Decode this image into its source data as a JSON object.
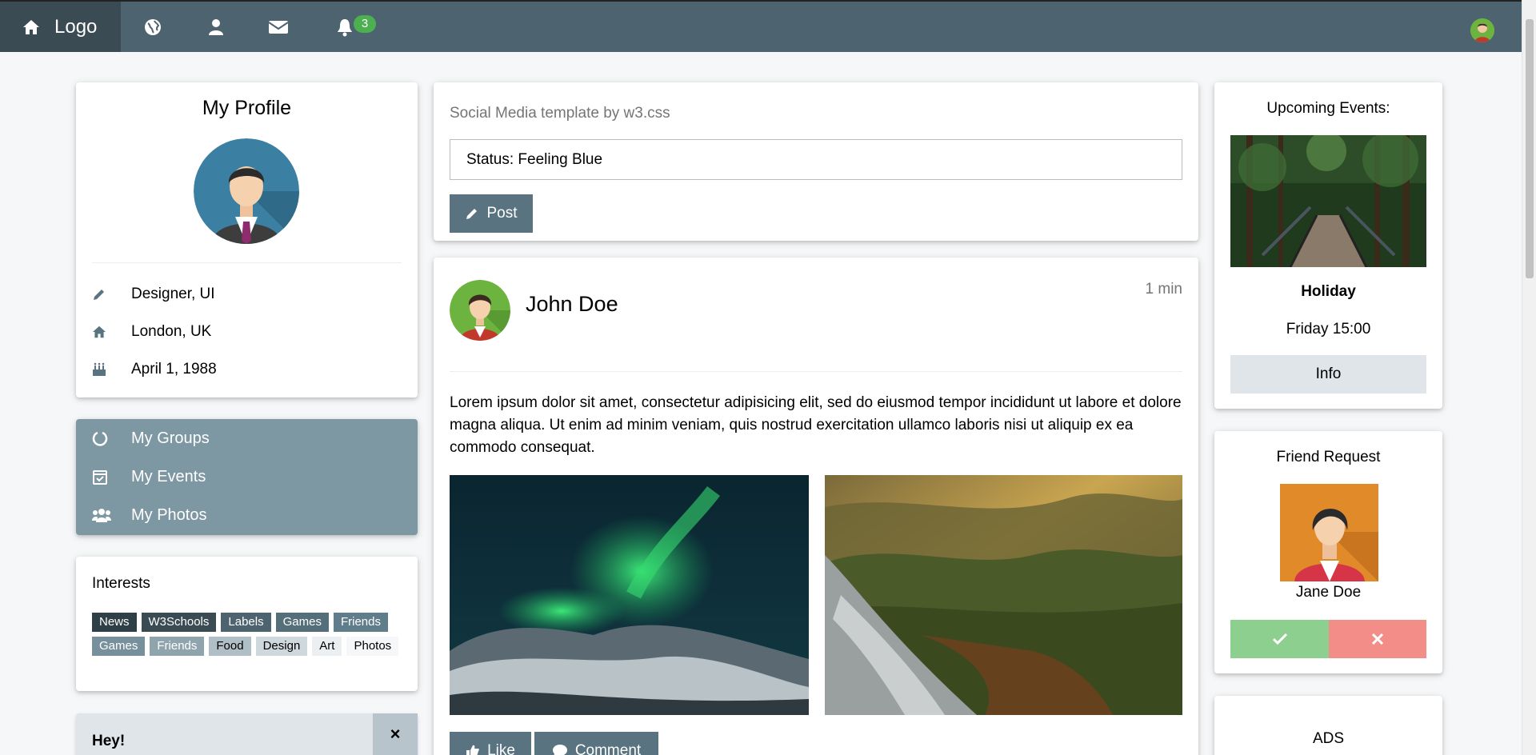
{
  "navbar": {
    "logo_label": "Logo",
    "icons": [
      "home-icon",
      "globe-icon",
      "user-icon",
      "envelope-icon",
      "bell-icon"
    ],
    "notification_count": "3"
  },
  "profile": {
    "title": "My Profile",
    "details": [
      {
        "icon": "pencil-icon",
        "text": "Designer, UI"
      },
      {
        "icon": "home-icon",
        "text": "London, UK"
      },
      {
        "icon": "birthday-cake-icon",
        "text": "April 1, 1988"
      }
    ]
  },
  "menu": {
    "items": [
      {
        "icon": "circle-notch-icon",
        "label": "My Groups"
      },
      {
        "icon": "calendar-check-icon",
        "label": "My Events"
      },
      {
        "icon": "users-icon",
        "label": "My Photos"
      }
    ]
  },
  "interests": {
    "title": "Interests",
    "tags": [
      {
        "label": "News",
        "bg": "#2f3f47",
        "fg": "#ffffff"
      },
      {
        "label": "W3Schools",
        "bg": "#3a4b54",
        "fg": "#ffffff"
      },
      {
        "label": "Labels",
        "bg": "#4d636f",
        "fg": "#ffffff"
      },
      {
        "label": "Games",
        "bg": "#546e7a",
        "fg": "#ffffff"
      },
      {
        "label": "Friends",
        "bg": "#607d8b",
        "fg": "#ffffff"
      },
      {
        "label": "Games",
        "bg": "#78909c",
        "fg": "#ffffff"
      },
      {
        "label": "Friends",
        "bg": "#90a4ae",
        "fg": "#ffffff"
      },
      {
        "label": "Food",
        "bg": "#b0bec5",
        "fg": "#000000"
      },
      {
        "label": "Design",
        "bg": "#cfd8dc",
        "fg": "#000000"
      },
      {
        "label": "Art",
        "bg": "#eceff1",
        "fg": "#000000"
      },
      {
        "label": "Photos",
        "bg": "#f5f7f8",
        "fg": "#000000"
      }
    ]
  },
  "alert": {
    "title": "Hey!",
    "close_label": "×"
  },
  "status": {
    "subtitle": "Social Media template by w3.css",
    "value": "Status: Feeling Blue",
    "post_label": "Post"
  },
  "post": {
    "author": "John Doe",
    "time": "1 min",
    "text": "Lorem ipsum dolor sit amet, consectetur adipisicing elit, sed do eiusmod tempor incididunt ut labore et dolore magna aliqua. Ut enim ad minim veniam, quis nostrud exercitation ullamco laboris nisi ut aliquip ex ea commodo consequat.",
    "like_label": "Like",
    "comment_label": "Comment"
  },
  "events": {
    "title": "Upcoming Events:",
    "event_name": "Holiday",
    "event_time": "Friday 15:00",
    "info_label": "Info"
  },
  "friend_request": {
    "title": "Friend Request",
    "name": "Jane Doe",
    "accept_icon": "check-icon",
    "decline_icon": "times-icon"
  },
  "ads": {
    "title": "ADS"
  },
  "colors": {
    "theme_d1": "#4d636f",
    "theme_d2": "#3a4b54",
    "accent_green": "#4caf50"
  }
}
